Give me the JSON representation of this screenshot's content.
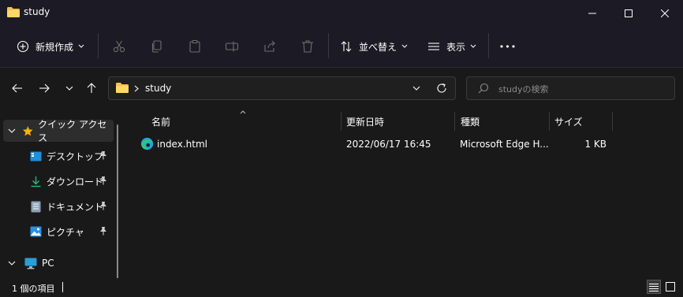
{
  "window": {
    "title": "study"
  },
  "toolbar": {
    "new_label": "新規作成",
    "sort_label": "並べ替え",
    "view_label": "表示",
    "more_label": "•••"
  },
  "address": {
    "path": "study",
    "search_placeholder": "studyの検索"
  },
  "nav": {
    "items": [
      {
        "label": "クイック アクセス"
      },
      {
        "label": "デスクトップ"
      },
      {
        "label": "ダウンロード"
      },
      {
        "label": "ドキュメント"
      },
      {
        "label": "ピクチャ"
      },
      {
        "label": "PC"
      }
    ]
  },
  "columns": {
    "name": "名前",
    "modified": "更新日時",
    "type": "種類",
    "size": "サイズ"
  },
  "files": [
    {
      "name": "index.html",
      "modified": "2022/06/17 16:45",
      "type": "Microsoft Edge H...",
      "size": "1 KB"
    }
  ],
  "status": {
    "count": "1 個の項目"
  },
  "colors": {
    "title_bg": "#1c1a24",
    "content_bg": "#191919",
    "folder": "#f5c44f",
    "star": "#f5b400",
    "edge": "#1fa6d8"
  }
}
